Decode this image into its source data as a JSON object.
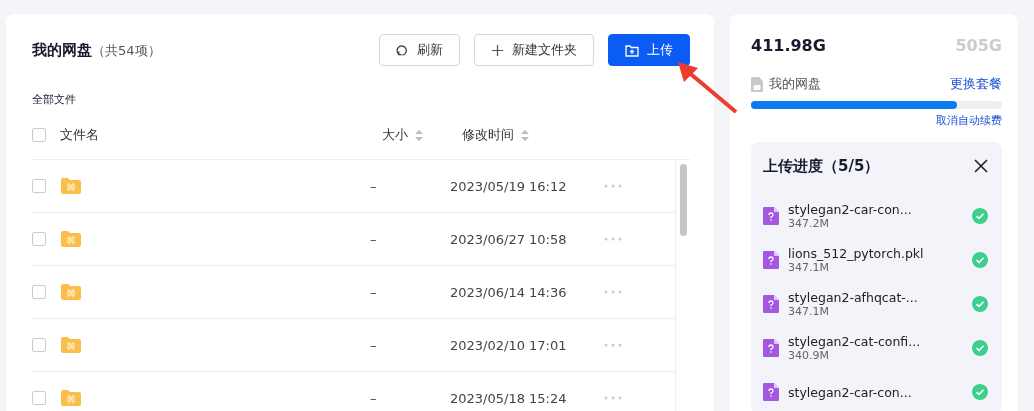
{
  "drive": {
    "title": "我的网盘",
    "count": "（共54项）",
    "buttons": [
      {
        "kind": "refresh",
        "label": "刷新"
      },
      {
        "kind": "new-folder",
        "label": "新建文件夹"
      },
      {
        "kind": "upload",
        "label": "上传"
      }
    ],
    "breadcrumb": "全部文件",
    "table": {
      "header_checked": false,
      "columns": [
        {
          "label": "文件名",
          "sortable": false
        },
        {
          "label": "大小",
          "sortable": true
        },
        {
          "label": "修改时间",
          "sortable": true
        }
      ],
      "rows": [
        {
          "checked": false,
          "size": "–",
          "modified": "2023/05/19 16:12"
        },
        {
          "checked": false,
          "size": "–",
          "modified": "2023/06/27 10:58"
        },
        {
          "checked": false,
          "size": "–",
          "modified": "2023/06/14 14:36"
        },
        {
          "checked": false,
          "size": "–",
          "modified": "2023/02/10 17:01"
        },
        {
          "checked": false,
          "size": "–",
          "modified": "2023/05/18 15:24"
        }
      ]
    }
  },
  "storage": {
    "used": "411.98G",
    "total": "505G",
    "label": "我的网盘",
    "change_plan": "更换套餐",
    "level": 0.82,
    "cancel_renewal": "取消自动续费"
  },
  "upload_progress": {
    "title": "上传进度（5/5）",
    "items": [
      {
        "name": "stylegan2-car-con...",
        "size": "347.2M",
        "done": true
      },
      {
        "name": "lions_512_pytorch.pkl",
        "size": "347.1M",
        "done": true
      },
      {
        "name": "stylegan2-afhqcat-...",
        "size": "347.1M",
        "done": true
      },
      {
        "name": "stylegan2-cat-confi...",
        "size": "340.9M",
        "done": true
      },
      {
        "name": "stylegan2-car-con...",
        "done": true
      }
    ]
  }
}
